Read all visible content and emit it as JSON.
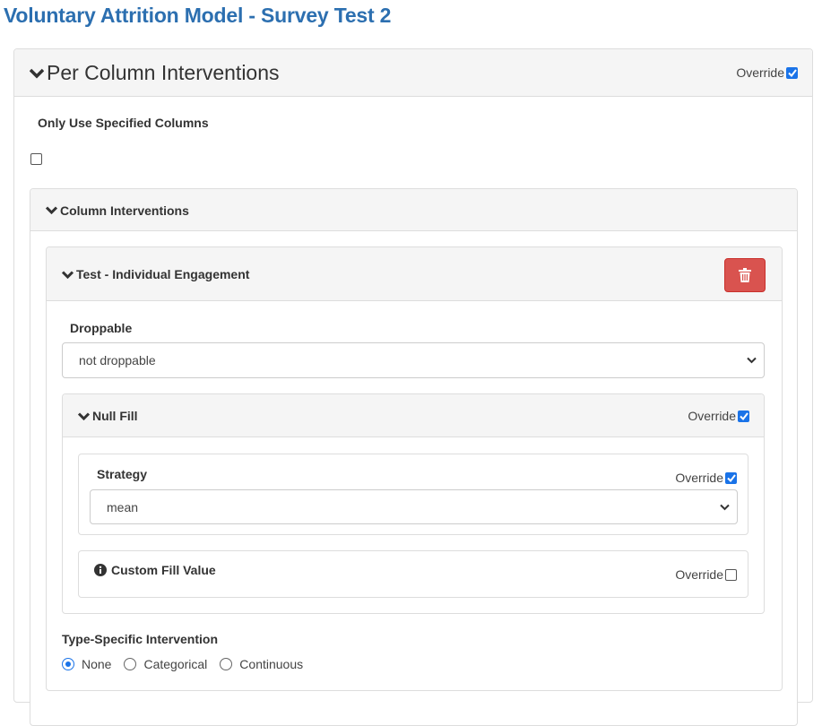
{
  "page_title": "Voluntary Attrition Model - Survey Test 2",
  "per_column": {
    "title": "Per Column Interventions",
    "override_label": "Override",
    "override_checked": true,
    "only_use_label": "Only Use Specified Columns",
    "only_use_checked": false
  },
  "column_interventions": {
    "title": "Column Interventions"
  },
  "test_card": {
    "title": "Test - Individual Engagement",
    "delete_icon": "trash-icon",
    "delete_color": "#d9534f",
    "droppable_label": "Droppable",
    "droppable_value": "not droppable",
    "null_fill": {
      "title": "Null Fill",
      "override_label": "Override",
      "override_checked": true,
      "strategy": {
        "label": "Strategy",
        "override_label": "Override",
        "override_checked": true,
        "value": "mean"
      },
      "custom_fill": {
        "label": "Custom Fill Value",
        "icon": "info-icon",
        "override_label": "Override",
        "override_checked": false
      }
    },
    "type_specific": {
      "label": "Type-Specific Intervention",
      "options": [
        "None",
        "Categorical",
        "Continuous"
      ],
      "selected": "None"
    }
  },
  "colors": {
    "accent": "#2c6fb0",
    "checkbox": "#1a73e8"
  }
}
